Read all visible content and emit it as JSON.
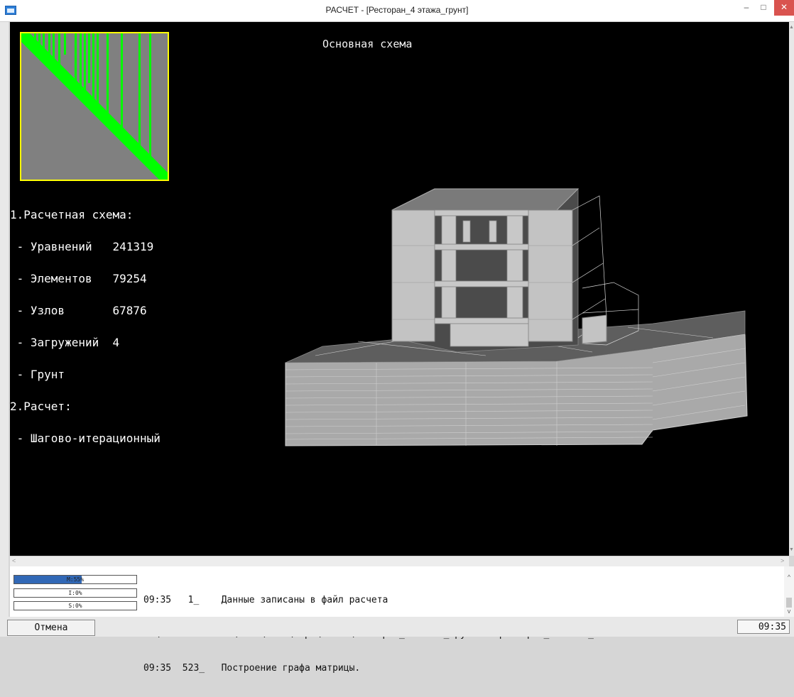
{
  "window": {
    "title": "РАСЧЕТ - [Ресторан_4 этажа_грунт]",
    "minimize": "–",
    "maximize": "□",
    "close": "✕"
  },
  "viewport": {
    "scheme_title": "Основная схема",
    "info_lines": [
      "1.Расчетная схема:",
      " - Уравнений   241319",
      " - Элементов   79254",
      " - Узлов       67876",
      " - Загружений  4",
      " - Грунт",
      "2.Расчет:",
      " - Шагово-итерационный"
    ],
    "matrix_color": "#00ff00",
    "matrix_border_color": "#ffff00"
  },
  "progress": {
    "memory": {
      "label": "M:55%",
      "value": 0.55
    },
    "io": {
      "label": "I:0%",
      "value": 0
    },
    "steps": {
      "label": "S:0%",
      "value": 0
    }
  },
  "log": {
    "lines": [
      "09:35   1_    Данные записаны в файл расчета",
      "E:\\WORK AND MISC\\Гоша\\WORK\\Лира\\LDATA\\Ресторан_4 этажа_грунт#00.ресторан_2 этажа_новый",
      "09:35  523_   Построение графа матрицы."
    ]
  },
  "footer": {
    "cancel_label": "Отмена",
    "time": "09:35"
  },
  "colors": {
    "progress_fill": "#3168b6",
    "viewport_bg": "#000000"
  }
}
